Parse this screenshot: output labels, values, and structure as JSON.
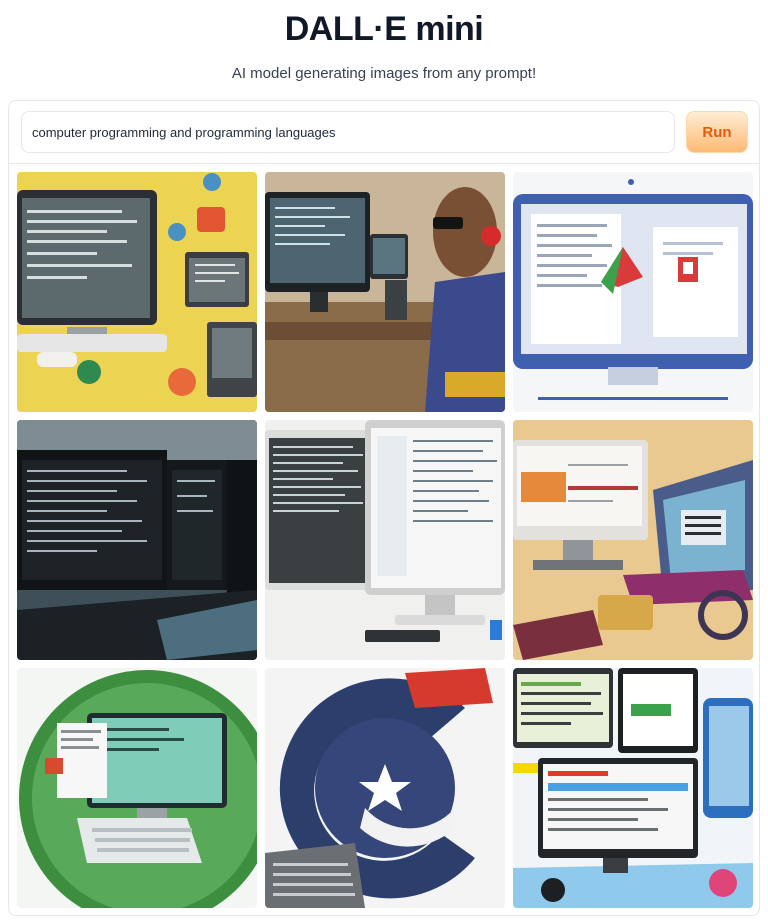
{
  "header": {
    "title": "DALL·E mini",
    "subtitle": "AI model generating images from any prompt!"
  },
  "prompt": {
    "value": "computer programming and programming languages",
    "run_label": "Run"
  },
  "gallery": {
    "images": [
      {
        "subject": "illustrated computer monitor with code on yellow background"
      },
      {
        "subject": "man with glasses working at computer monitor showing code"
      },
      {
        "subject": "blue computer monitor with document and red-green logo"
      },
      {
        "subject": "multiple dark monitors displaying code"
      },
      {
        "subject": "white monitors with code spreadsheets"
      },
      {
        "subject": "illustrated monitor and laptop on beige background"
      },
      {
        "subject": "computer and keyboard on green circle"
      },
      {
        "subject": "blue circular logo with white star and keyboard"
      },
      {
        "subject": "illustrated monitors with web pages and code"
      }
    ]
  },
  "colors": {
    "accent_text": "#ea580c",
    "accent_bg": "#fdba74"
  }
}
